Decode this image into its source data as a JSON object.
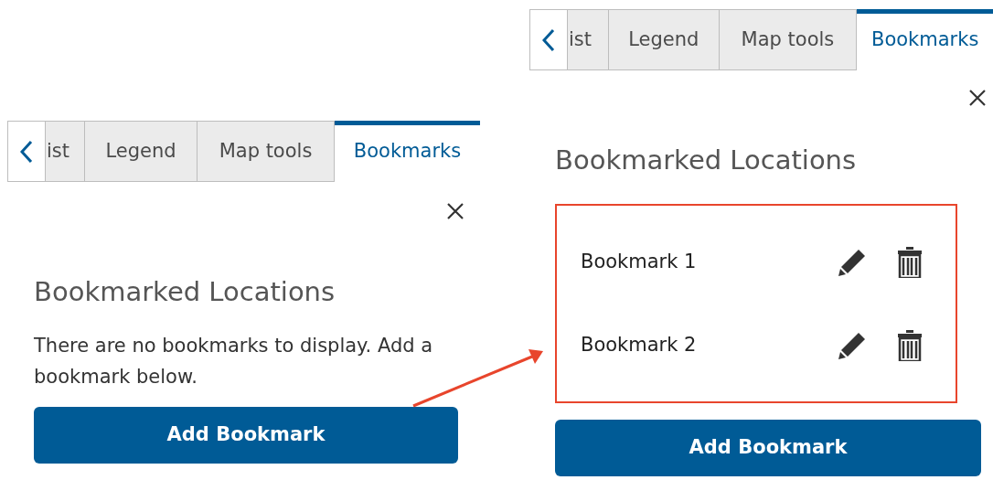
{
  "panels": [
    {
      "tabs": [
        {
          "label": "ist",
          "selected": false
        },
        {
          "label": "Legend",
          "selected": false
        },
        {
          "label": "Map tools",
          "selected": false
        },
        {
          "label": "Bookmarks",
          "selected": true
        }
      ],
      "heading": "Bookmarked Locations",
      "message": "There are no bookmarks to display. Add a bookmark below.",
      "button": "Add Bookmark"
    },
    {
      "tabs": [
        {
          "label": "ist",
          "selected": false
        },
        {
          "label": "Legend",
          "selected": false
        },
        {
          "label": "Map tools",
          "selected": false
        },
        {
          "label": "Bookmarks",
          "selected": true
        }
      ],
      "heading": "Bookmarked Locations",
      "bookmarks": [
        {
          "name": "Bookmark 1"
        },
        {
          "name": "Bookmark 2"
        }
      ],
      "button": "Add Bookmark"
    }
  ]
}
